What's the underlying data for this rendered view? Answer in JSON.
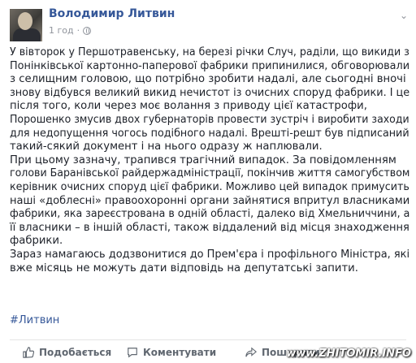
{
  "post": {
    "author": "Володимир Литвин",
    "time": "1 год",
    "hashtag": "#Литвин"
  },
  "text_lines": [
    "У вівторок у Першотравенську, на березі річки Случ, раділи, що викиди з",
    "Понінківської картонно-паперової фабрики припинилися, обговорювали",
    "з селищним головою, що потрібно зробити надалі, але сьогодні вночі",
    "знову відбувся великий викид нечистот із очисних споруд фабрики. І це",
    "після того, коли через моє волання з приводу цієї катастрофи,",
    "Порошенко змусив двох губернаторів провести зустріч і виробити заходи",
    "для недопущення чогось подібного надалі. Врешті-решт був підписаний",
    "такий-сякий документ і на нього одразу ж наплювали.",
    "При цьому зазначу, трапився трагічний випадок. За повідомленням",
    "голови Баранівської райдержадміністрації, покінчив життя самогубством",
    "керівник очисних споруд цієї фабрики. Можливо цей випадок примусить",
    "наші «доблесні» правоохоронні органи зайнятися впритул власниками",
    "фабрики, яка зареєстрована в одній області, далеко від Хмельниччини, а",
    "її власники – в іншій області, також віддалений від місця знаходження",
    "фабрики.",
    "Зараз намагаюсь додзвонитися до Прем'єра і профільного Міністра, які",
    "вже місяць не можуть дати відповідь на депутатські запити."
  ],
  "actions": {
    "like": "Подобається",
    "comment": "Коментувати",
    "share": "Поширити"
  },
  "watermark": "www.ZHITOMIR.INFO",
  "colors": {
    "link": "#365899",
    "muted": "#90949c",
    "text": "#1d2129"
  }
}
